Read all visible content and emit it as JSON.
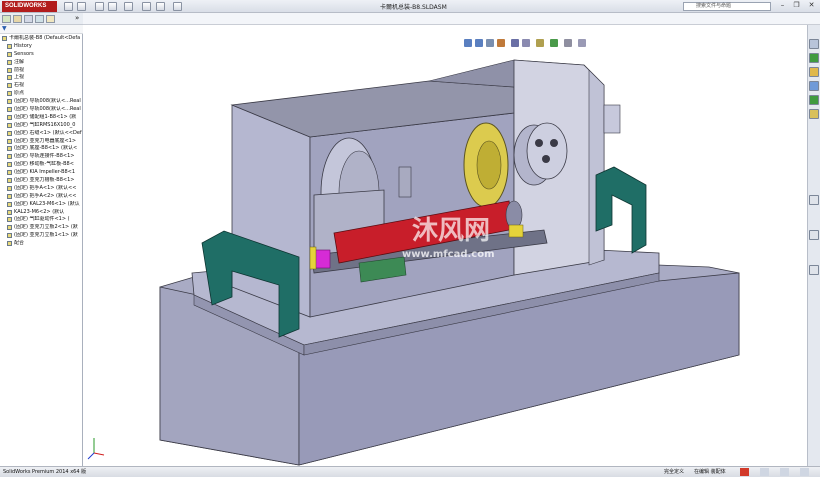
{
  "titlebar": {
    "app_logo": "SOLIDWORKS",
    "document_title": "卡爾机总装-B8.SLDASM",
    "search_placeholder": "搜索文件与命题",
    "window_controls": [
      "minimize",
      "restore",
      "close"
    ]
  },
  "feature_tree": {
    "items": [
      {
        "label": "卡爾机总装-B8 (Default<Defa",
        "icon": "assembly-icon",
        "indent": 0
      },
      {
        "label": "History",
        "icon": "history-icon",
        "indent": 1
      },
      {
        "label": "Sensors",
        "icon": "sensors-icon",
        "indent": 1
      },
      {
        "label": "注解",
        "icon": "annotations-icon",
        "indent": 1
      },
      {
        "label": "前视",
        "icon": "plane-icon",
        "indent": 1
      },
      {
        "label": "上视",
        "icon": "plane-icon",
        "indent": 1
      },
      {
        "label": "右视",
        "icon": "plane-icon",
        "indent": 1
      },
      {
        "label": "原点",
        "icon": "origin-icon",
        "indent": 1
      },
      {
        "label": "(固定) 导轨008(默认<...Real",
        "icon": "part-icon",
        "indent": 1
      },
      {
        "label": "(固定) 导轨008(默认<...Real",
        "icon": "part-icon",
        "indent": 1
      },
      {
        "label": "(固定) 储配组1-B8<1> (默",
        "icon": "part-icon",
        "indent": 1
      },
      {
        "label": "(固定) 气缸RMS16X100_0",
        "icon": "part-icon",
        "indent": 1
      },
      {
        "label": "(固定) 右缝<1> (默认<<Def",
        "icon": "part-icon",
        "indent": 1
      },
      {
        "label": "(固定) 亚克力电器底座<1>",
        "icon": "part-icon",
        "indent": 1
      },
      {
        "label": "(固定) 底座-B8<1> (默认<",
        "icon": "part-icon",
        "indent": 1
      },
      {
        "label": "(固定) 导轨连接件-B8<1>",
        "icon": "part-icon",
        "indent": 1
      },
      {
        "label": "(固定) 移动板-气缸板-B8<",
        "icon": "part-icon",
        "indent": 1
      },
      {
        "label": "(固定) KIA Impeller-B8<1",
        "icon": "part-icon",
        "indent": 1
      },
      {
        "label": "(固定) 亚克力槽板-B8<1>",
        "icon": "part-icon",
        "indent": 1
      },
      {
        "label": "(固定) 把手A<1> (默认<<",
        "icon": "part-icon",
        "indent": 1
      },
      {
        "label": "(固定) 把手A<2> (默认<<",
        "icon": "part-icon",
        "indent": 1
      },
      {
        "label": "(固定) KAL23-M6<1> (默认",
        "icon": "part-icon",
        "indent": 1
      },
      {
        "label": "KAL23-M6<2> (默认",
        "icon": "part-icon",
        "indent": 1
      },
      {
        "label": "(固定) 气缸驱动件<1> (",
        "icon": "part-icon",
        "indent": 1
      },
      {
        "label": "(固定) 亚克力立板2<1> (默",
        "icon": "part-icon",
        "indent": 1
      },
      {
        "label": "(固定) 亚克力立板1<1> (默",
        "icon": "part-icon",
        "indent": 1
      },
      {
        "label": "配合",
        "icon": "mates-icon",
        "indent": 1
      }
    ]
  },
  "watermark": {
    "brand": "沐风网",
    "url": "www.mfcad.com"
  },
  "statusbar": {
    "version": "SolidWorks Premium 2014 x64 版",
    "constraint": "完全定义",
    "editing": "在编辑 装配体"
  },
  "colors": {
    "part_gray": "#b3b5cf",
    "dark_plate": "#6f7287",
    "handle_teal": "#1f6e66",
    "cylinder_red": "#c81e2a",
    "gear_yellow": "#d9c84a",
    "accent_magenta": "#d62bd6",
    "slide_green": "#3d8a55"
  }
}
